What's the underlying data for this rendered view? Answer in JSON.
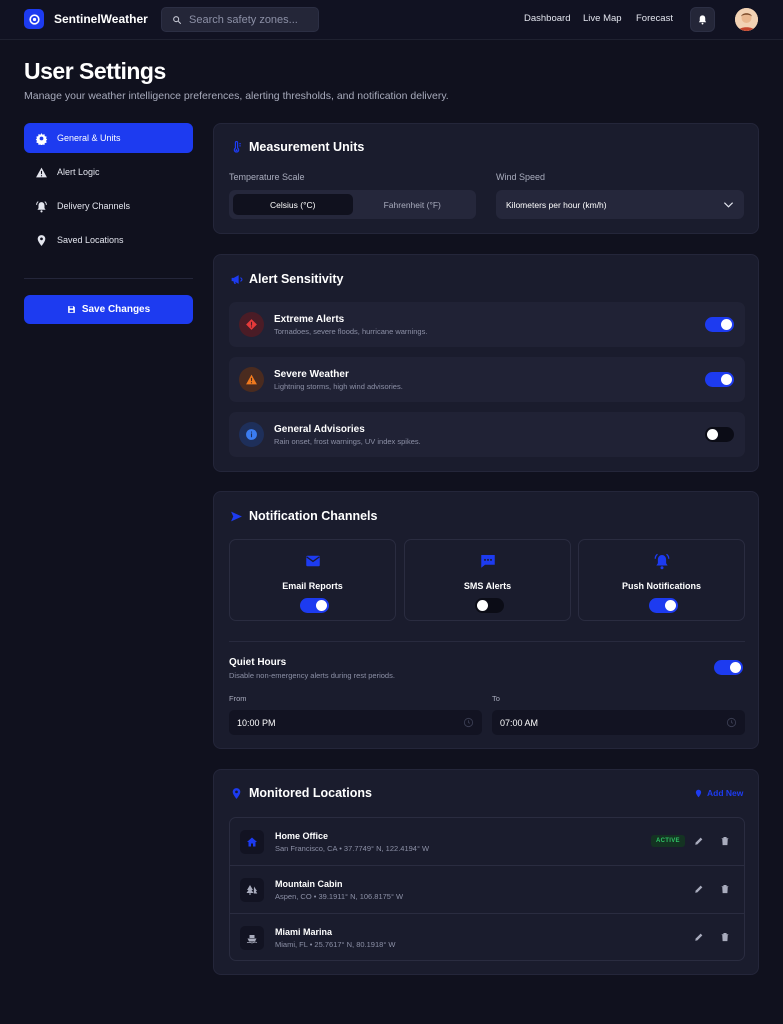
{
  "app": {
    "name": "SentinelWeather"
  },
  "search": {
    "placeholder": "Search safety zones..."
  },
  "nav": [
    "Dashboard",
    "Live Map",
    "Forecast"
  ],
  "page": {
    "title": "User Settings",
    "subtitle": "Manage your weather intelligence preferences, alerting thresholds, and notification delivery."
  },
  "sidebar": {
    "items": [
      {
        "label": "General & Units",
        "icon": "gear-icon",
        "active": true
      },
      {
        "label": "Alert Logic",
        "icon": "warning-icon",
        "active": false
      },
      {
        "label": "Delivery Channels",
        "icon": "bell-ring-icon",
        "active": false
      },
      {
        "label": "Saved Locations",
        "icon": "pin-icon",
        "active": false
      }
    ],
    "save_label": "Save Changes"
  },
  "units": {
    "title": "Measurement Units",
    "temp_label": "Temperature Scale",
    "temp_options": [
      "Celsius (°C)",
      "Fahrenheit (°F)"
    ],
    "temp_selected": "Celsius (°C)",
    "wind_label": "Wind Speed",
    "wind_value": "Kilometers per hour (km/h)"
  },
  "alerts": {
    "title": "Alert Sensitivity",
    "items": [
      {
        "title": "Extreme Alerts",
        "desc": "Tornadoes, severe floods, hurricane warnings.",
        "enabled": true,
        "color": "#e53a3a"
      },
      {
        "title": "Severe Weather",
        "desc": "Lightning storms, high wind advisories.",
        "enabled": true,
        "color": "#f07a1e"
      },
      {
        "title": "General Advisories",
        "desc": "Rain onset, frost warnings, UV index spikes.",
        "enabled": false,
        "color": "#3b7cf0"
      }
    ]
  },
  "notifications": {
    "title": "Notification Channels",
    "channels": [
      {
        "name": "Email Reports",
        "enabled": true,
        "icon": "mail-icon"
      },
      {
        "name": "SMS Alerts",
        "enabled": false,
        "icon": "sms-icon"
      },
      {
        "name": "Push Notifications",
        "enabled": true,
        "icon": "bell-ring-icon"
      }
    ],
    "quiet": {
      "title": "Quiet Hours",
      "desc": "Disable non-emergency alerts during rest periods.",
      "enabled": true,
      "from_label": "From",
      "from_value": "10:00 PM",
      "to_label": "To",
      "to_value": "07:00 AM"
    }
  },
  "locations": {
    "title": "Monitored Locations",
    "add_label": "Add New",
    "items": [
      {
        "name": "Home Office",
        "coords": "San Francisco, CA • 37.7749° N, 122.4194° W",
        "badge": "ACTIVE",
        "icon": "home-icon"
      },
      {
        "name": "Mountain Cabin",
        "coords": "Aspen, CO • 39.1911° N, 106.8175° W",
        "badge": "",
        "icon": "trees-icon"
      },
      {
        "name": "Miami Marina",
        "coords": "Miami, FL • 25.7617° N, 80.1918° W",
        "badge": "",
        "icon": "boat-icon"
      }
    ]
  },
  "colors": {
    "accent": "#1d3bf0",
    "background": "#10111e",
    "card": "#1a1c2d",
    "success": "#2fc466"
  }
}
